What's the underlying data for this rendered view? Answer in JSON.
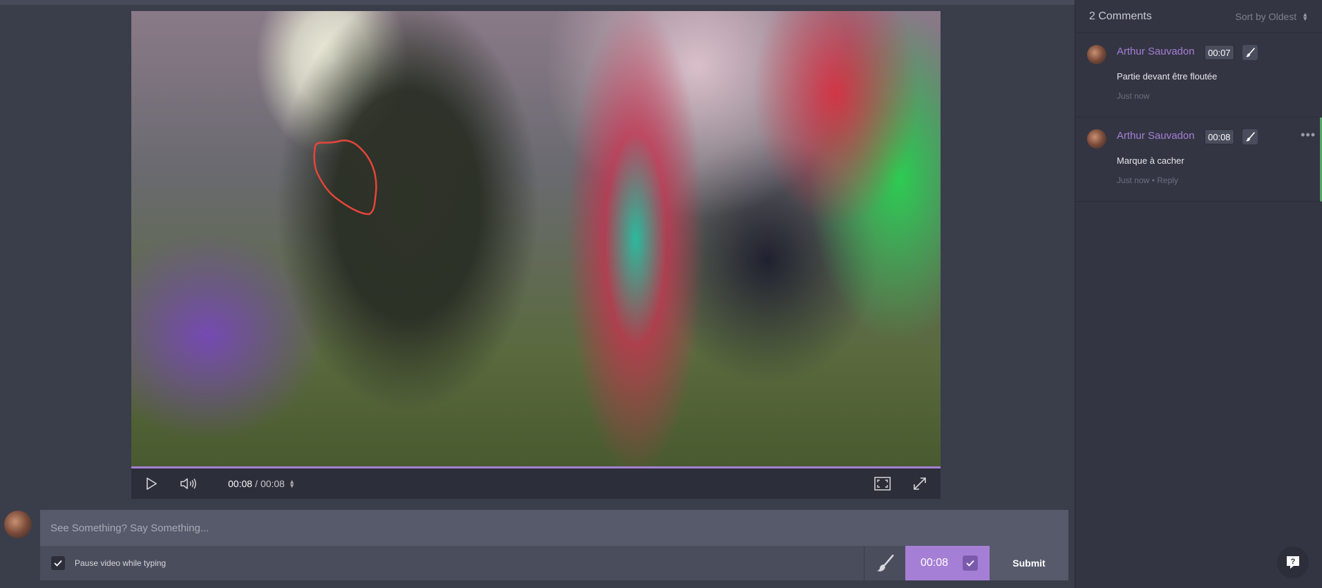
{
  "player": {
    "current_time": "00:08",
    "separator": "/",
    "total_time": "00:08",
    "progress_fraction": 1.0
  },
  "composer": {
    "placeholder": "See Something? Say Something...",
    "pause_label": "Pause video while typing",
    "pause_checked": true,
    "timestamp": "00:08",
    "submit_label": "Submit"
  },
  "sidebar": {
    "count_label": "2 Comments",
    "sort_label": "Sort by Oldest",
    "comments": [
      {
        "author": "Arthur Sauvadon",
        "time": "00:07",
        "text": "Partie devant être floutée",
        "meta": "Just now",
        "reply": ""
      },
      {
        "author": "Arthur Sauvadon",
        "time": "00:08",
        "text": "Marque à cacher",
        "meta": "Just now",
        "reply": " • Reply",
        "more": "•••"
      }
    ]
  },
  "colors": {
    "accent": "#a57fd6",
    "background": "#3a3d4a",
    "sidebar": "#333542",
    "annotation": "#e8453c",
    "active_indicator": "#5aa66a"
  },
  "icons": {
    "play": "play-icon",
    "volume": "volume-icon",
    "fit": "fit-screen-icon",
    "fullscreen": "fullscreen-icon",
    "brush": "brush-icon",
    "check": "check-icon",
    "help": "help-chat-icon"
  }
}
